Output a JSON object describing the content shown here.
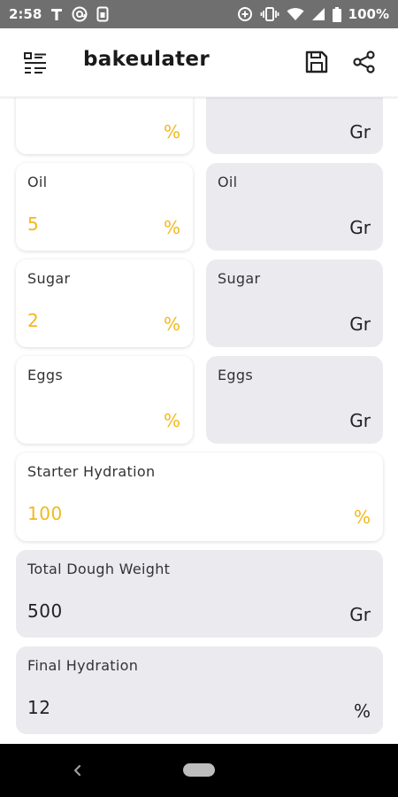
{
  "status_bar": {
    "time": "2:58",
    "battery": "100%",
    "left_icons": [
      "t-icon",
      "at-icon",
      "sim-icon"
    ],
    "right_icons": [
      "data-saver-icon",
      "vibrate-icon",
      "wifi-icon",
      "signal-icon",
      "battery-icon"
    ]
  },
  "app_bar": {
    "title": "bakeulater",
    "icons": [
      "menu-list-icon",
      "save-icon",
      "share-icon"
    ]
  },
  "colors": {
    "accent": "#f2b81c",
    "card_gray": "#ebebef",
    "status_bar": "#6f6f6f"
  },
  "fields": {
    "top_left": {
      "label": "",
      "value": "",
      "unit": "%"
    },
    "top_right": {
      "label": "",
      "value": "",
      "unit": "Gr"
    },
    "oil_pct": {
      "label": "Oil",
      "value": "5",
      "unit": "%"
    },
    "oil_gr": {
      "label": "Oil",
      "value": "",
      "unit": "Gr"
    },
    "sugar_pct": {
      "label": "Sugar",
      "value": "2",
      "unit": "%"
    },
    "sugar_gr": {
      "label": "Sugar",
      "value": "",
      "unit": "Gr"
    },
    "eggs_pct": {
      "label": "Eggs",
      "value": "",
      "unit": "%"
    },
    "eggs_gr": {
      "label": "Eggs",
      "value": "",
      "unit": "Gr"
    },
    "starter_hydration": {
      "label": "Starter Hydration",
      "value": "100",
      "unit": "%"
    },
    "total_dough_weight": {
      "label": "Total Dough Weight",
      "value": "500",
      "unit": "Gr"
    },
    "final_hydration": {
      "label": "Final Hydration",
      "value": "12",
      "unit": "%"
    }
  }
}
